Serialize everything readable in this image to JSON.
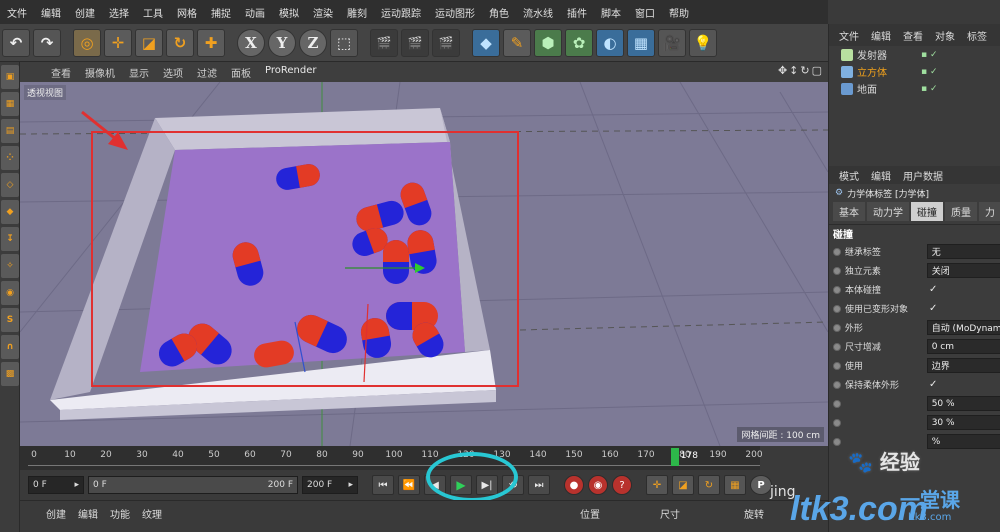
{
  "menu": [
    "文件",
    "编辑",
    "创建",
    "选择",
    "工具",
    "网格",
    "捕捉",
    "动画",
    "模拟",
    "渲染",
    "雕刻",
    "运动跟踪",
    "运动图形",
    "角色",
    "流水线",
    "插件",
    "脚本",
    "窗口",
    "帮助"
  ],
  "toolbar": {
    "undo": "↶",
    "redo": "↷",
    "axis_x": "X",
    "axis_y": "Y",
    "axis_z": "Z"
  },
  "viewport_menu": [
    "查看",
    "摄像机",
    "显示",
    "选项",
    "过滤",
    "面板",
    "ProRender"
  ],
  "viewport_label": "透视视图",
  "grid_info": "网格间距 : 100 cm",
  "timeline": {
    "ticks": [
      "0",
      "10",
      "20",
      "30",
      "40",
      "50",
      "60",
      "70",
      "80",
      "90",
      "100",
      "110",
      "120",
      "130",
      "140",
      "150",
      "160",
      "170",
      "180",
      "190",
      "200"
    ],
    "current_frame": "178",
    "current_frame_value": 178,
    "start_field": "0 F",
    "slider_start": "0 F",
    "slider_end": "200 F",
    "end_field": "200 F"
  },
  "bottom": {
    "left_menu": [
      "创建",
      "编辑",
      "功能",
      "纹理"
    ],
    "coord_labels": [
      "位置",
      "尺寸",
      "旋转"
    ]
  },
  "object_manager": {
    "tabs": [
      "文件",
      "编辑",
      "查看",
      "对象",
      "标签"
    ],
    "objects": [
      {
        "name": "发射器",
        "color": "#b8e0a0",
        "active": false
      },
      {
        "name": "立方体",
        "color": "#7fb0e0",
        "active": true
      },
      {
        "name": "地面",
        "color": "#6a9ad0",
        "active": false
      }
    ]
  },
  "attributes": {
    "modes": [
      "模式",
      "编辑",
      "用户数据"
    ],
    "title": "力学体标签 [力学体]",
    "tabs": [
      "基本",
      "动力学",
      "碰撞",
      "质量",
      "力"
    ],
    "active_tab": "碰撞",
    "section": "碰撞",
    "rows": [
      {
        "label": "继承标签",
        "value": "无"
      },
      {
        "label": "独立元素",
        "value": "关闭"
      },
      {
        "label": "本体碰撞",
        "value": "✓"
      },
      {
        "label": "使用已变形对象",
        "value": "✓"
      },
      {
        "label": "外形",
        "value": "自动 (MoDynam"
      },
      {
        "label": "尺寸增减",
        "value": "0 cm"
      },
      {
        "label": "使用",
        "value": "边界"
      },
      {
        "label": "保持柔体外形",
        "value": "✓"
      },
      {
        "label": "",
        "value": "50 %"
      },
      {
        "label": "",
        "value": "30 %"
      },
      {
        "label": "",
        "value": "%"
      }
    ]
  },
  "watermark": {
    "jingyan": "经验",
    "jingyan_sub": "jing",
    "site": "ltk3.com",
    "cn": "一堂课",
    "cn_sub": "ltk3.com"
  },
  "colors": {
    "accent": "#f0a020",
    "highlight_box": "#e03030",
    "play_ring": "#28c7d3",
    "viewport_bg": "#7d7a96",
    "pill_red": "#e33b25",
    "pill_blue": "#2424d8",
    "container_floor": "#9b73c9"
  }
}
